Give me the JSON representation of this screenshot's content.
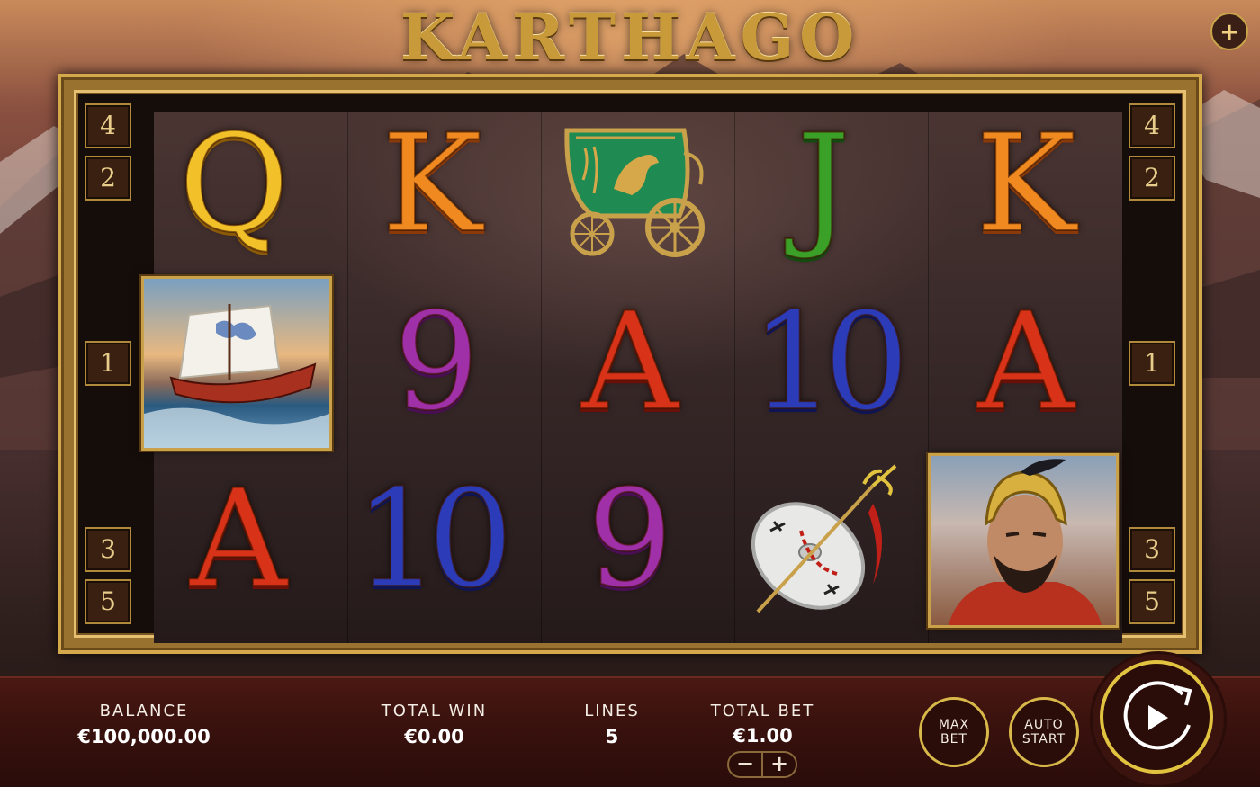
{
  "game": {
    "title": "KARTHAGO",
    "menu_icon": "plus-icon",
    "menu_label": "+"
  },
  "paylines": {
    "left": [
      "4",
      "2",
      "1",
      "3",
      "5"
    ],
    "right": [
      "4",
      "2",
      "1",
      "3",
      "5"
    ]
  },
  "reels": [
    [
      "Q",
      "ship",
      "A"
    ],
    [
      "K",
      "9",
      "10"
    ],
    [
      "chariot",
      "A",
      "9"
    ],
    [
      "J",
      "10",
      "shield"
    ],
    [
      "K",
      "A",
      "warrior"
    ]
  ],
  "symbols": {
    "r1_top": "Q",
    "r2_top": "K",
    "r4_top": "J",
    "r5_top": "K",
    "r2_mid": "9",
    "r3_mid": "A",
    "r4_mid": "10",
    "r5_mid": "A",
    "r1_bot": "A",
    "r2_bot": "10",
    "r3_bot": "9",
    "ship": "ship-icon",
    "chariot": "chariot-icon",
    "shield": "shield-icon",
    "warrior": "warrior-icon"
  },
  "bar": {
    "balance_label": "BALANCE",
    "balance_value": "€100,000.00",
    "total_win_label": "TOTAL WIN",
    "total_win_value": "€0.00",
    "lines_label": "LINES",
    "lines_value": "5",
    "total_bet_label": "TOTAL BET",
    "total_bet_value": "€1.00",
    "bet_minus": "−",
    "bet_plus": "+",
    "max_bet_label": "MAX\nBET",
    "auto_start_label": "AUTO\nSTART",
    "spin_icon": "spin-icon"
  },
  "colors": {
    "gold": "#d4a94c",
    "bar_bg": "#3a120e",
    "spin_ring": "#e2c340"
  }
}
